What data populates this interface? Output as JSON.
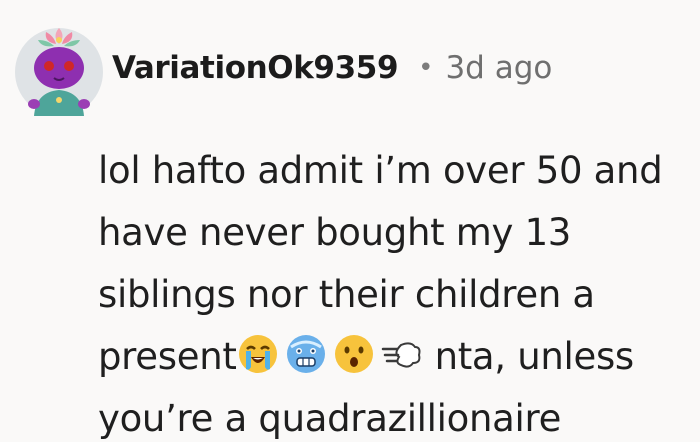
{
  "comment": {
    "username": "VariationOk9359",
    "separator": "•",
    "timestamp": "3d ago",
    "lines": [
      "lol hafto admit i’m over 50 and",
      "have never bought my 13",
      "siblings nor their children a",
      "present",
      "nta, unless",
      "you’re a quadrazillionaire"
    ],
    "emojis": [
      "loudly-crying-face-icon",
      "cold-face-icon",
      "astonished-face-icon",
      "dashing-away-icon"
    ],
    "avatar_icon": "reddit-snoo-avatar-icon"
  }
}
